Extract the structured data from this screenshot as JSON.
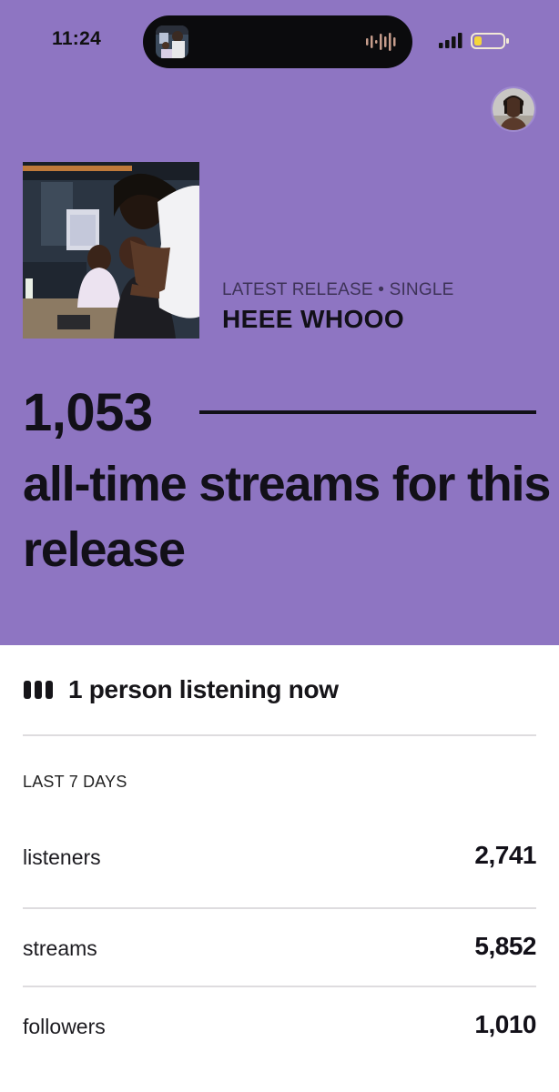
{
  "status_bar": {
    "time": "11:24"
  },
  "theme": {
    "hero_background": "#8e75c2",
    "text_dark": "#121018",
    "divider": "#dedcdf"
  },
  "release": {
    "label": "LATEST RELEASE • SINGLE",
    "title": "HEEE WHOOO"
  },
  "all_time": {
    "count": "1,053",
    "caption": "all-time streams for this release"
  },
  "live": {
    "icon": "live-bars-icon",
    "text": "1 person listening now"
  },
  "last_7_days": {
    "label": "LAST 7 DAYS",
    "stats": [
      {
        "label": "listeners",
        "value": "2,741"
      },
      {
        "label": "streams",
        "value": "5,852"
      },
      {
        "label": "followers",
        "value": "1,010"
      }
    ]
  }
}
